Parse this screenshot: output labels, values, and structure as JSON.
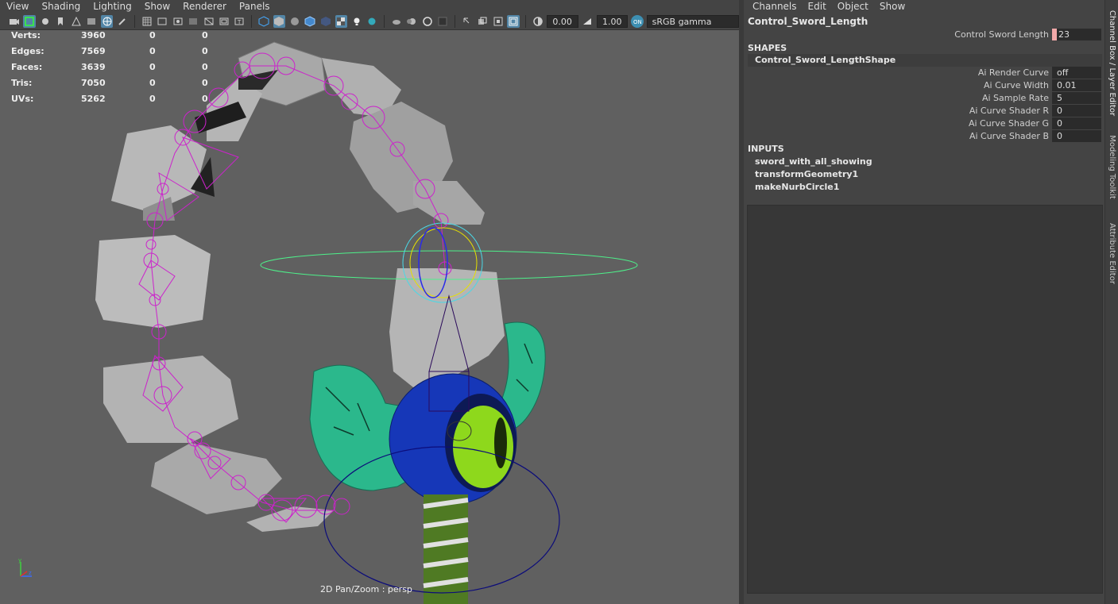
{
  "viewport": {
    "menus": [
      "View",
      "Shading",
      "Lighting",
      "Show",
      "Renderer",
      "Panels"
    ],
    "toolbar": {
      "exposure_value": "0.00",
      "gamma_value": "1.00",
      "colorspace_label": "sRGB gamma"
    },
    "hud": {
      "rows": [
        {
          "label": "Verts:",
          "v1": "3960",
          "v2": "0",
          "v3": "0"
        },
        {
          "label": "Edges:",
          "v1": "7569",
          "v2": "0",
          "v3": "0"
        },
        {
          "label": "Faces:",
          "v1": "3639",
          "v2": "0",
          "v3": "0"
        },
        {
          "label": "Tris:",
          "v1": "7050",
          "v2": "0",
          "v3": "0"
        },
        {
          "label": "UVs:",
          "v1": "5262",
          "v2": "0",
          "v3": "0"
        }
      ]
    },
    "camera_label": "2D Pan/Zoom : persp",
    "axis_labels": {
      "y": "y",
      "z": "z"
    }
  },
  "channel_box": {
    "menus": [
      "Channels",
      "Edit",
      "Object",
      "Show"
    ],
    "object_name": "Control_Sword_Length",
    "main_attr": {
      "label": "Control Sword Length",
      "value": "23"
    },
    "shapes_header": "SHAPES",
    "shape_name": "Control_Sword_LengthShape",
    "shape_attrs": [
      {
        "label": "Ai Render Curve",
        "value": "off"
      },
      {
        "label": "Ai Curve Width",
        "value": "0.01"
      },
      {
        "label": "Ai Sample Rate",
        "value": "5"
      },
      {
        "label": "Ai Curve Shader R",
        "value": "0"
      },
      {
        "label": "Ai Curve Shader G",
        "value": "0"
      },
      {
        "label": "Ai Curve Shader B",
        "value": "0"
      }
    ],
    "inputs_header": "INPUTS",
    "inputs": [
      "sword_with_all_showing",
      "transformGeometry1",
      "makeNurbCircle1"
    ]
  },
  "side_tabs": [
    "Channel Box / Layer Editor",
    "Modeling Toolkit",
    "Attribute Editor"
  ],
  "colors": {
    "viewport_bg": "#606060",
    "joint_magenta": "#cc22cc",
    "fin_teal": "#2bb88c",
    "ring_blue": "#1637b8",
    "eye_green": "#8ed81c",
    "key_pink": "#f1a8a8",
    "active_tool_blue": "#5285a6"
  }
}
